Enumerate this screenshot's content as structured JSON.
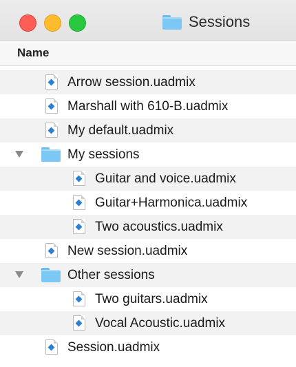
{
  "window": {
    "title": "Sessions",
    "title_icon": "folder-icon"
  },
  "columns": {
    "name_header": "Name"
  },
  "colors": {
    "close": "#fd5f57",
    "minimize": "#febb2e",
    "zoom": "#28c940",
    "folder": "#7cc8f4",
    "file_accent": "#2f7fd0"
  },
  "items": [
    {
      "label": "Arrow session.uadmix",
      "kind": "file",
      "level": 0
    },
    {
      "label": "Marshall with 610-B.uadmix",
      "kind": "file",
      "level": 0
    },
    {
      "label": "My default.uadmix",
      "kind": "file",
      "level": 0
    },
    {
      "label": "My sessions",
      "kind": "folder",
      "level": 0,
      "expanded": true
    },
    {
      "label": "Guitar and voice.uadmix",
      "kind": "file",
      "level": 1
    },
    {
      "label": "Guitar+Harmonica.uadmix",
      "kind": "file",
      "level": 1
    },
    {
      "label": "Two acoustics.uadmix",
      "kind": "file",
      "level": 1
    },
    {
      "label": "New session.uadmix",
      "kind": "file",
      "level": 0
    },
    {
      "label": "Other sessions",
      "kind": "folder",
      "level": 0,
      "expanded": true
    },
    {
      "label": "Two guitars.uadmix",
      "kind": "file",
      "level": 1
    },
    {
      "label": "Vocal Acoustic.uadmix",
      "kind": "file",
      "level": 1
    },
    {
      "label": "Session.uadmix",
      "kind": "file",
      "level": 0
    }
  ]
}
